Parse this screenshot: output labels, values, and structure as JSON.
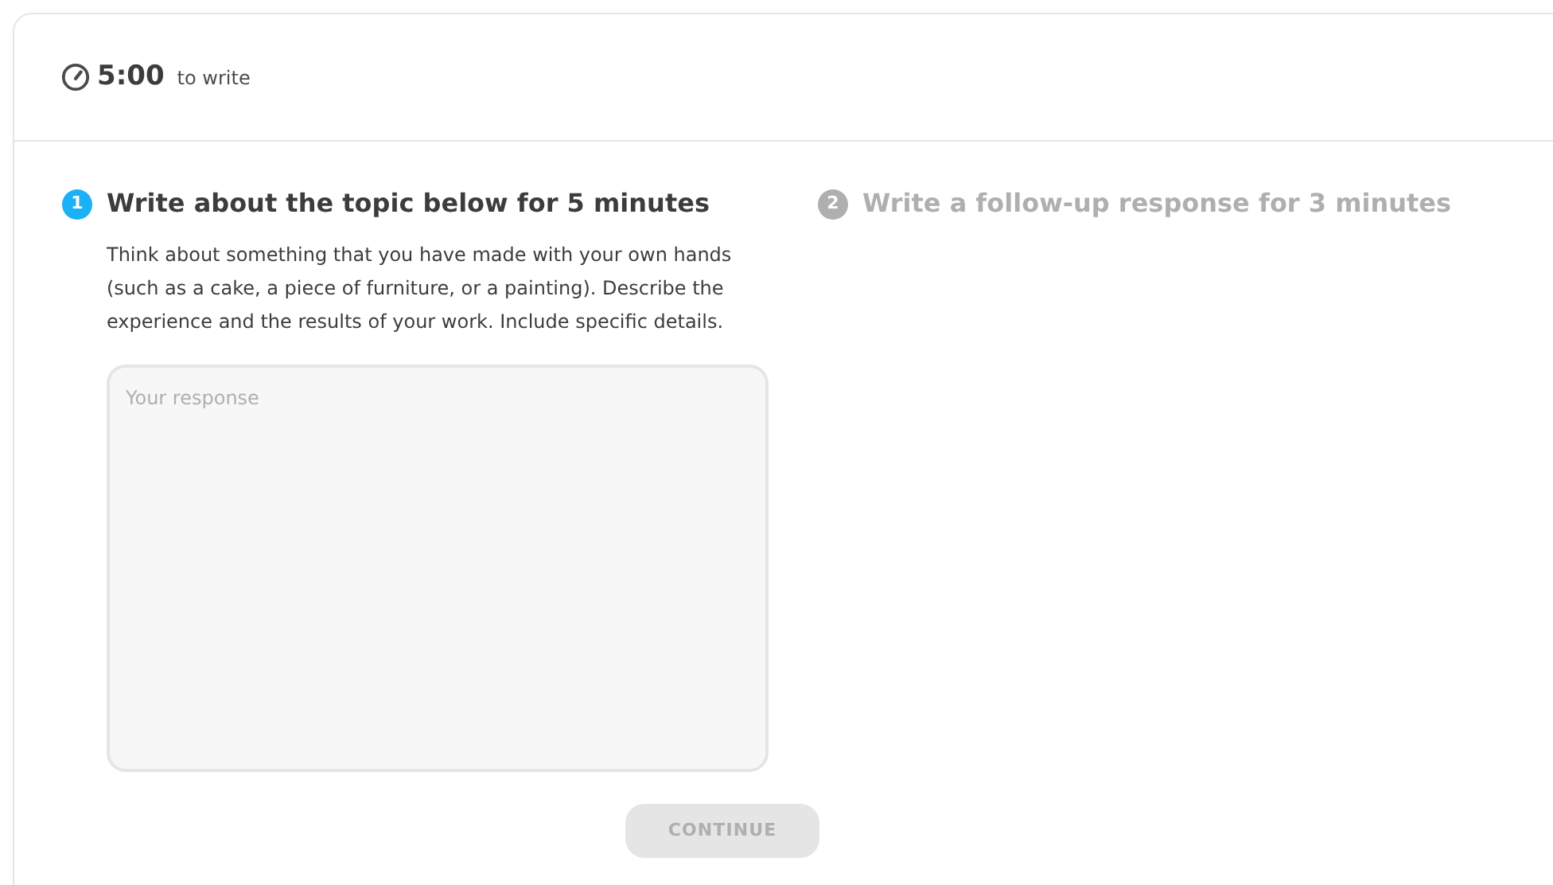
{
  "timer": {
    "time": "5:00",
    "label": "to write"
  },
  "steps": [
    {
      "number": "1",
      "title": "Write about the topic below for 5 minutes",
      "selected": true,
      "prompt": "Think about something that you have made with your own hands (such as a cake, a piece of furniture, or a painting). Describe the experience and the results of your work. Include specific details.",
      "response": {
        "placeholder": "Your response"
      },
      "button": {
        "label": "CONTINUE",
        "disabled": true
      }
    },
    {
      "number": "2",
      "title": "Write a follow-up response for 3 minutes",
      "selected": false
    }
  ]
}
